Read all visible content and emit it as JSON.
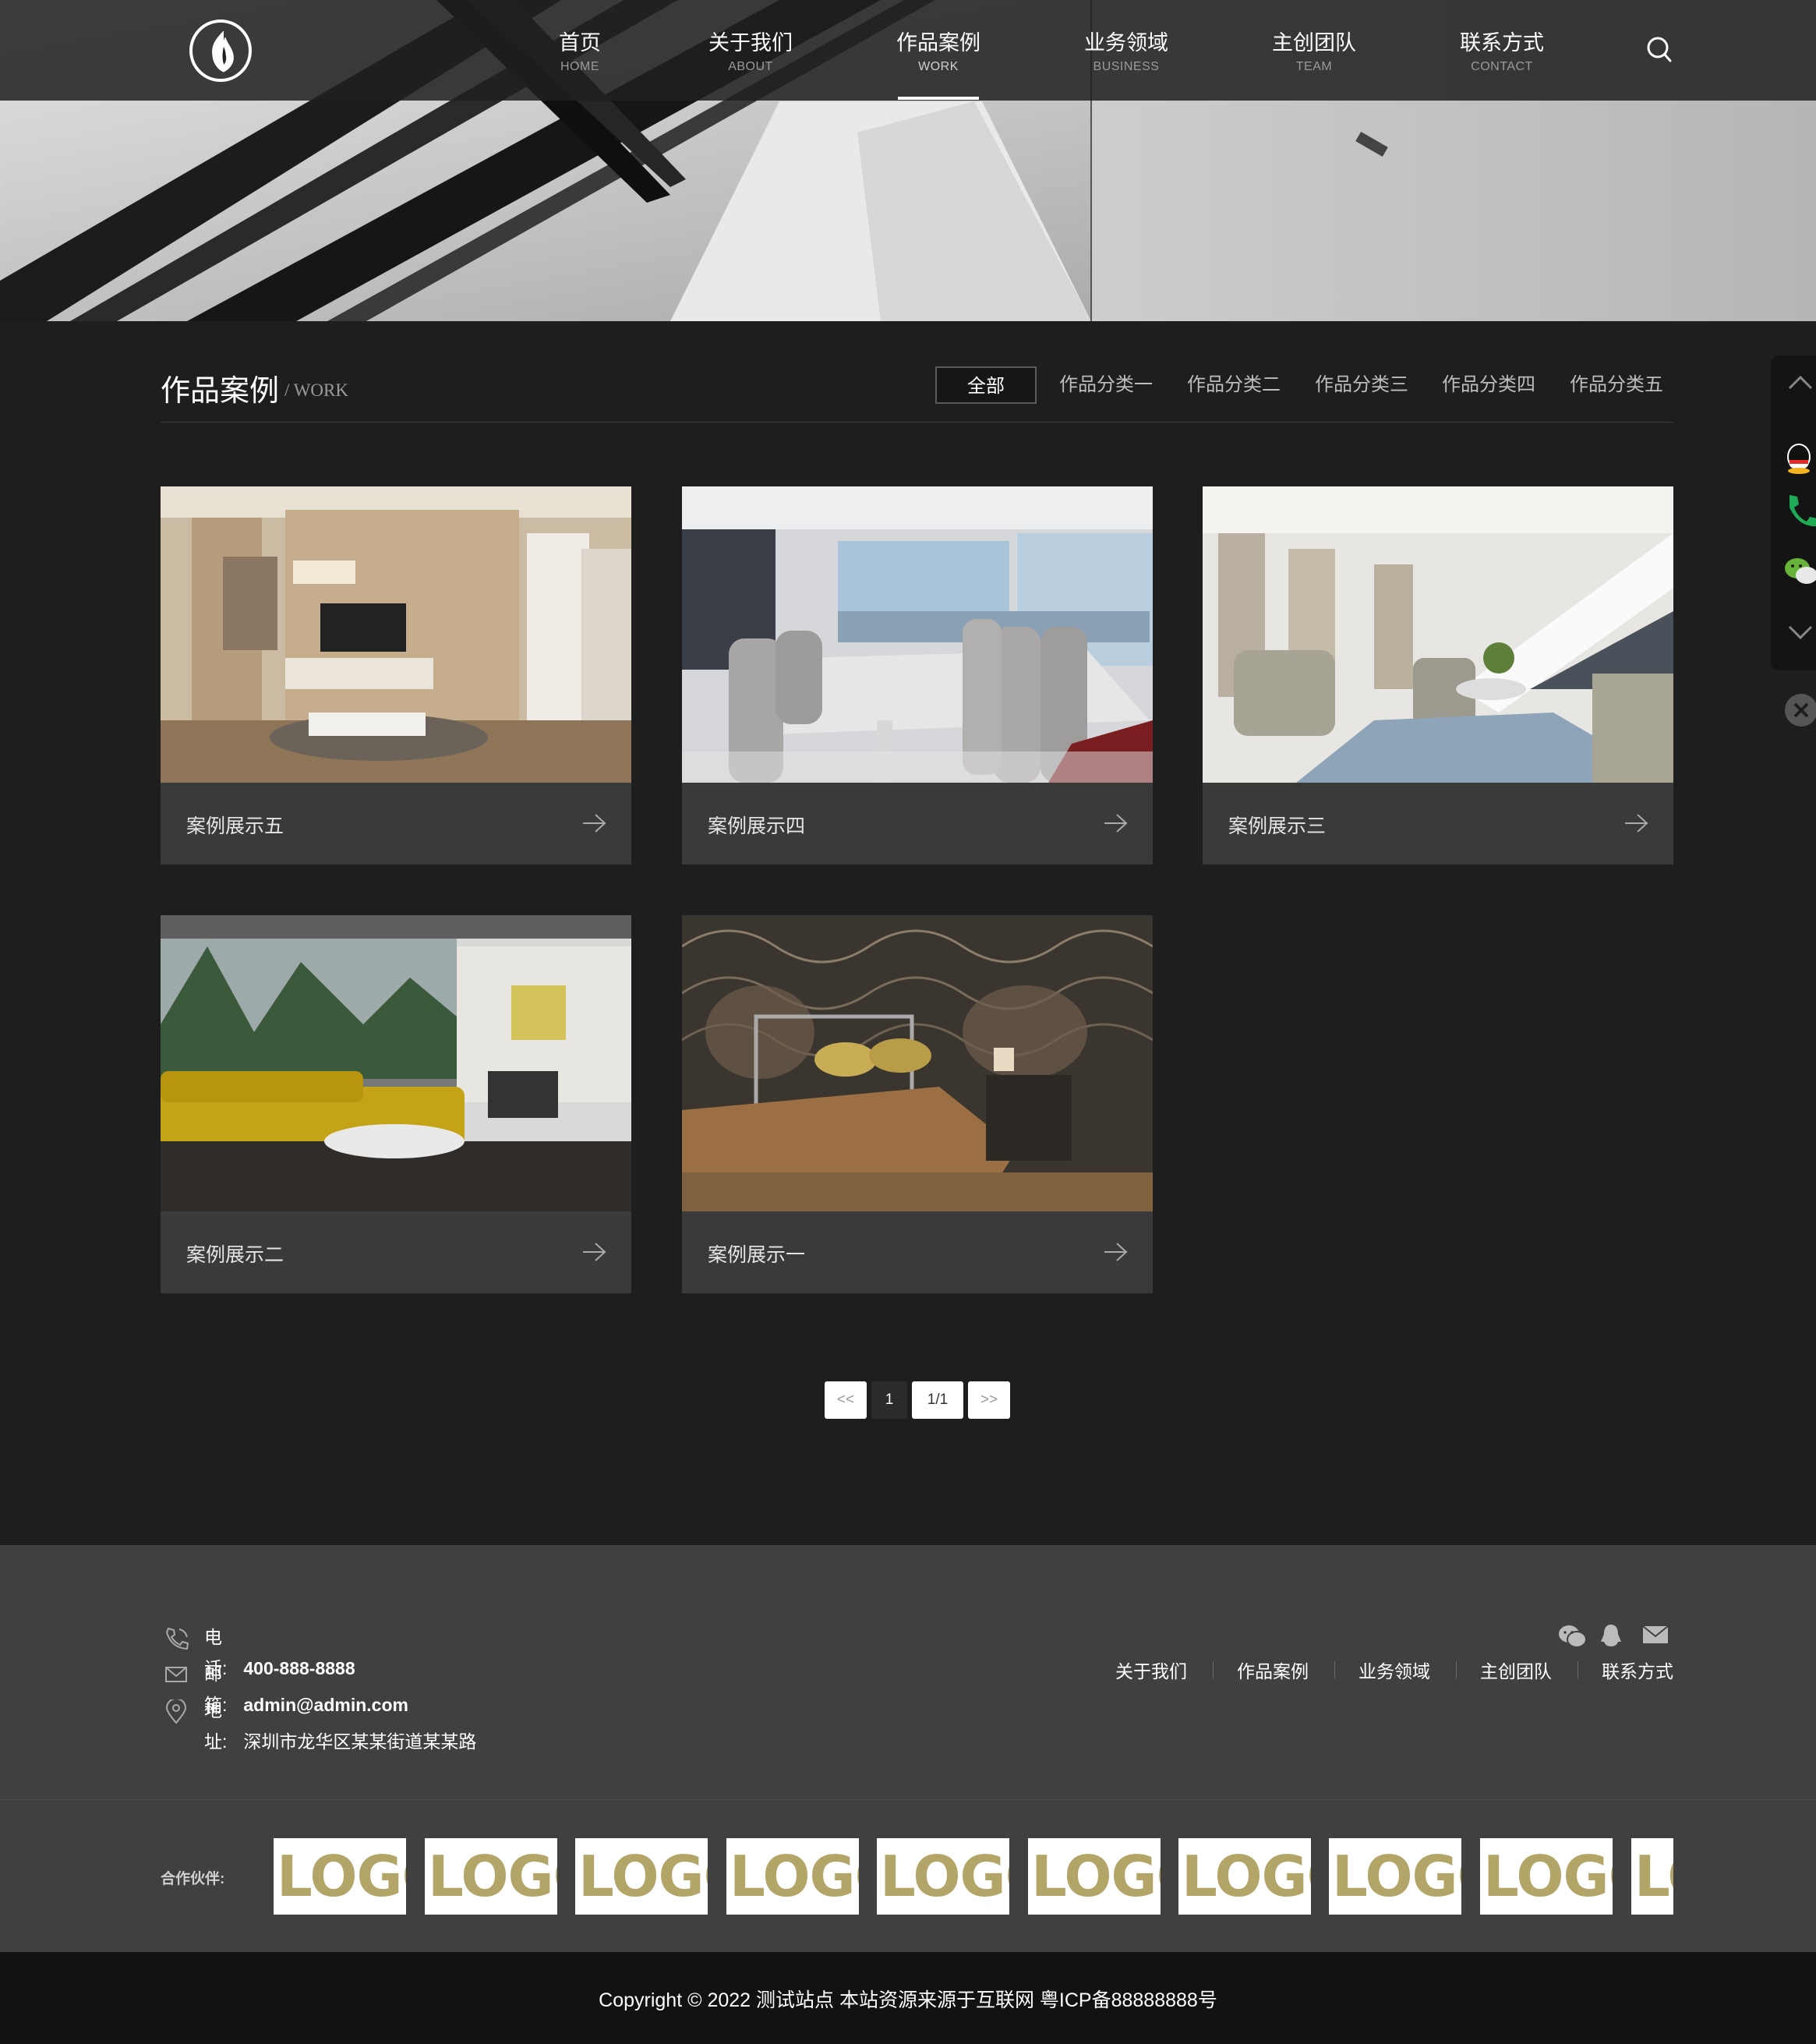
{
  "nav": {
    "items": [
      {
        "zh": "首页",
        "en": "HOME"
      },
      {
        "zh": "关于我们",
        "en": "ABOUT"
      },
      {
        "zh": "作品案例",
        "en": "WORK"
      },
      {
        "zh": "业务领域",
        "en": "BUSINESS"
      },
      {
        "zh": "主创团队",
        "en": "TEAM"
      },
      {
        "zh": "联系方式",
        "en": "CONTACT"
      }
    ],
    "active": "作品案例"
  },
  "section": {
    "title": "作品案例",
    "subtitle": "/ WORK",
    "categories": [
      "全部",
      "作品分类一",
      "作品分类二",
      "作品分类三",
      "作品分类四",
      "作品分类五"
    ]
  },
  "cases": [
    {
      "title": "案例展示五"
    },
    {
      "title": "案例展示四"
    },
    {
      "title": "案例展示三"
    },
    {
      "title": "案例展示二"
    },
    {
      "title": "案例展示一"
    }
  ],
  "pagination": {
    "first": "<<",
    "current": "1",
    "info": "1/1",
    "last": ">>"
  },
  "footer": {
    "phone_label": "电　话:",
    "phone": "400-888-8888",
    "email_label": "邮　箱:",
    "email": "admin@admin.com",
    "address_label": "地　址:",
    "address": "深圳市龙华区某某街道某某路",
    "links": [
      "关于我们",
      "作品案例",
      "业务领域",
      "主创团队",
      "联系方式"
    ],
    "partners_label": "合作伙伴:",
    "partners": [
      "LOGO",
      "LOGO",
      "LOGO",
      "LOGO",
      "LOGO",
      "LOGO",
      "LOGO",
      "LOGO",
      "LOGO",
      "LOGO"
    ],
    "copyright": "Copyright © 2022 测试站点 本站资源来源于互联网 粤ICP备88888888号"
  },
  "colors": {
    "background": "#1e1e1f",
    "footer": "#404041",
    "logo_gold": "#b3a567"
  }
}
